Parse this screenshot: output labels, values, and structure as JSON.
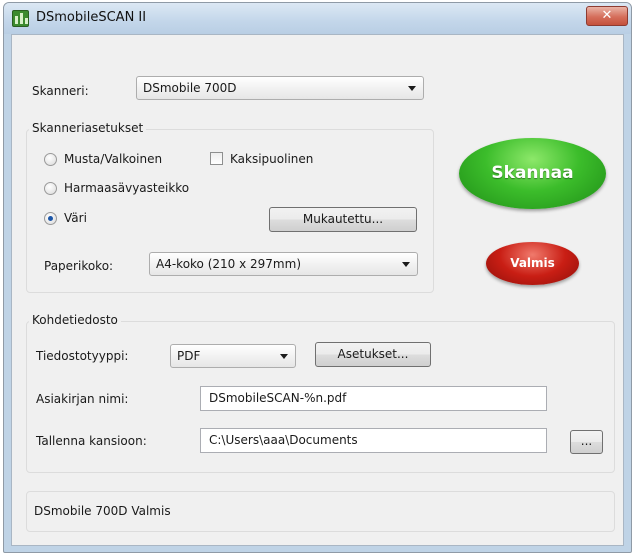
{
  "window": {
    "title": "DSmobileSCAN II",
    "close_glyph": "✕"
  },
  "scanner": {
    "label": "Skanneri:",
    "selected": "DSmobile 700D"
  },
  "settings": {
    "group_title": "Skanneriasetukset",
    "color_modes": [
      {
        "label": "Musta/Valkoinen",
        "checked": false
      },
      {
        "label": "Harmaasävyasteikko",
        "checked": false
      },
      {
        "label": "Väri",
        "checked": true
      }
    ],
    "duplex_label": "Kaksipuolinen",
    "duplex_checked": false,
    "custom_button": "Mukautettu...",
    "paper_label": "Paperikoko:",
    "paper_selected": "A4-koko (210 x 297mm)"
  },
  "actions": {
    "scan_label": "Skannaa",
    "done_label": "Valmis",
    "scan_color": "#3cbd2b",
    "done_color": "#c91e14"
  },
  "target": {
    "group_title": "Kohdetiedosto",
    "filetype_label": "Tiedostotyyppi:",
    "filetype_selected": "PDF",
    "settings_button": "Asetukset...",
    "docname_label": "Asiakirjan nimi:",
    "docname_value": "DSmobileSCAN-%n.pdf",
    "folder_label": "Tallenna kansioon:",
    "folder_value": "C:\\Users\\aaa\\Documents",
    "browse_button": "..."
  },
  "status": {
    "text": "DSmobile 700D Valmis"
  }
}
